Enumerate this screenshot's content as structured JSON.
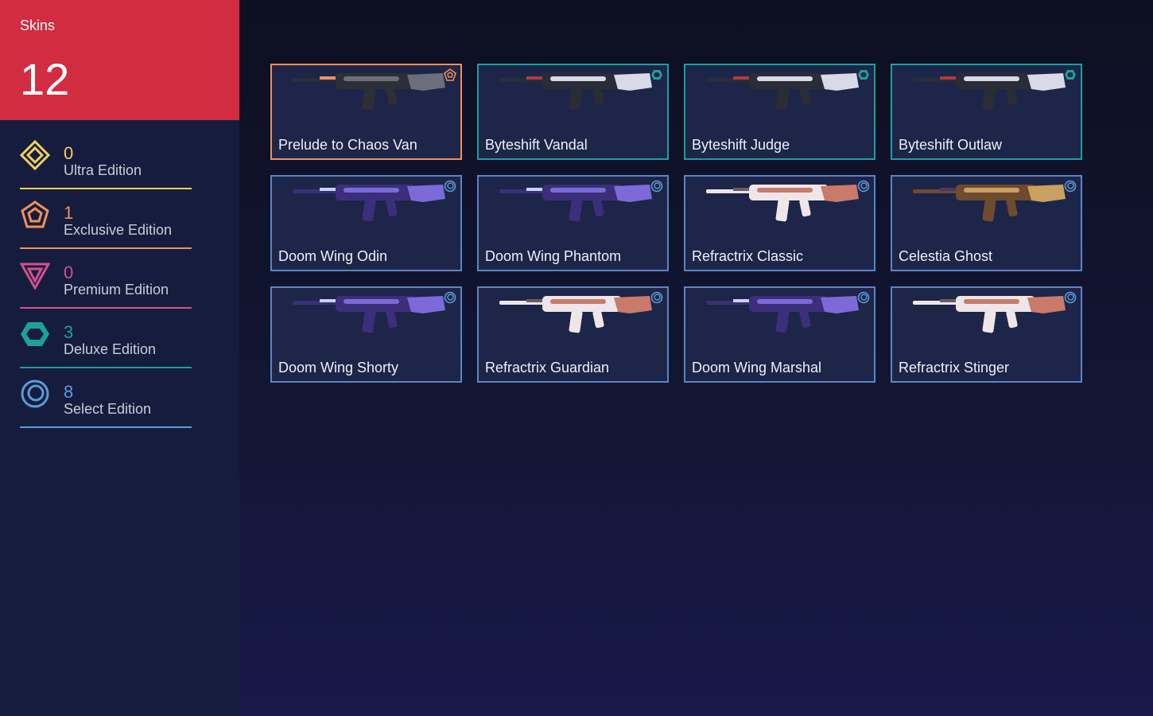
{
  "summary": {
    "label": "Skins",
    "count": "12"
  },
  "colors": {
    "summary_bg": "#d22c41",
    "ultra": "#f1d15e",
    "exclusive": "#f0905a",
    "premium": "#d2508f",
    "deluxe": "#1ba09a",
    "select": "#5b9bd8"
  },
  "tiers": [
    {
      "count": "0",
      "name": "Ultra Edition",
      "icon": "ultra-edition-icon",
      "color": "#f1d15e"
    },
    {
      "count": "1",
      "name": "Exclusive Edition",
      "icon": "exclusive-edition-icon",
      "color": "#f0905a"
    },
    {
      "count": "0",
      "name": "Premium Edition",
      "icon": "premium-edition-icon",
      "color": "#d2508f"
    },
    {
      "count": "3",
      "name": "Deluxe Edition",
      "icon": "deluxe-edition-icon",
      "color": "#1ba09a"
    },
    {
      "count": "8",
      "name": "Select Edition",
      "icon": "select-edition-icon",
      "color": "#5b9bd8"
    }
  ],
  "skins": [
    {
      "name": "Prelude to Chaos Van",
      "tier": "exclusive"
    },
    {
      "name": "Byteshift Vandal",
      "tier": "deluxe"
    },
    {
      "name": "Byteshift Judge",
      "tier": "deluxe"
    },
    {
      "name": "Byteshift Outlaw",
      "tier": "deluxe"
    },
    {
      "name": "Doom Wing Odin",
      "tier": "select"
    },
    {
      "name": "Doom Wing Phantom",
      "tier": "select"
    },
    {
      "name": "Refractrix Classic",
      "tier": "select"
    },
    {
      "name": "Celestia Ghost",
      "tier": "select"
    },
    {
      "name": "Doom Wing Shorty",
      "tier": "select"
    },
    {
      "name": "Refractrix Guardian",
      "tier": "select"
    },
    {
      "name": "Doom Wing Marshal",
      "tier": "select"
    },
    {
      "name": "Refractrix Stinger",
      "tier": "select"
    }
  ]
}
